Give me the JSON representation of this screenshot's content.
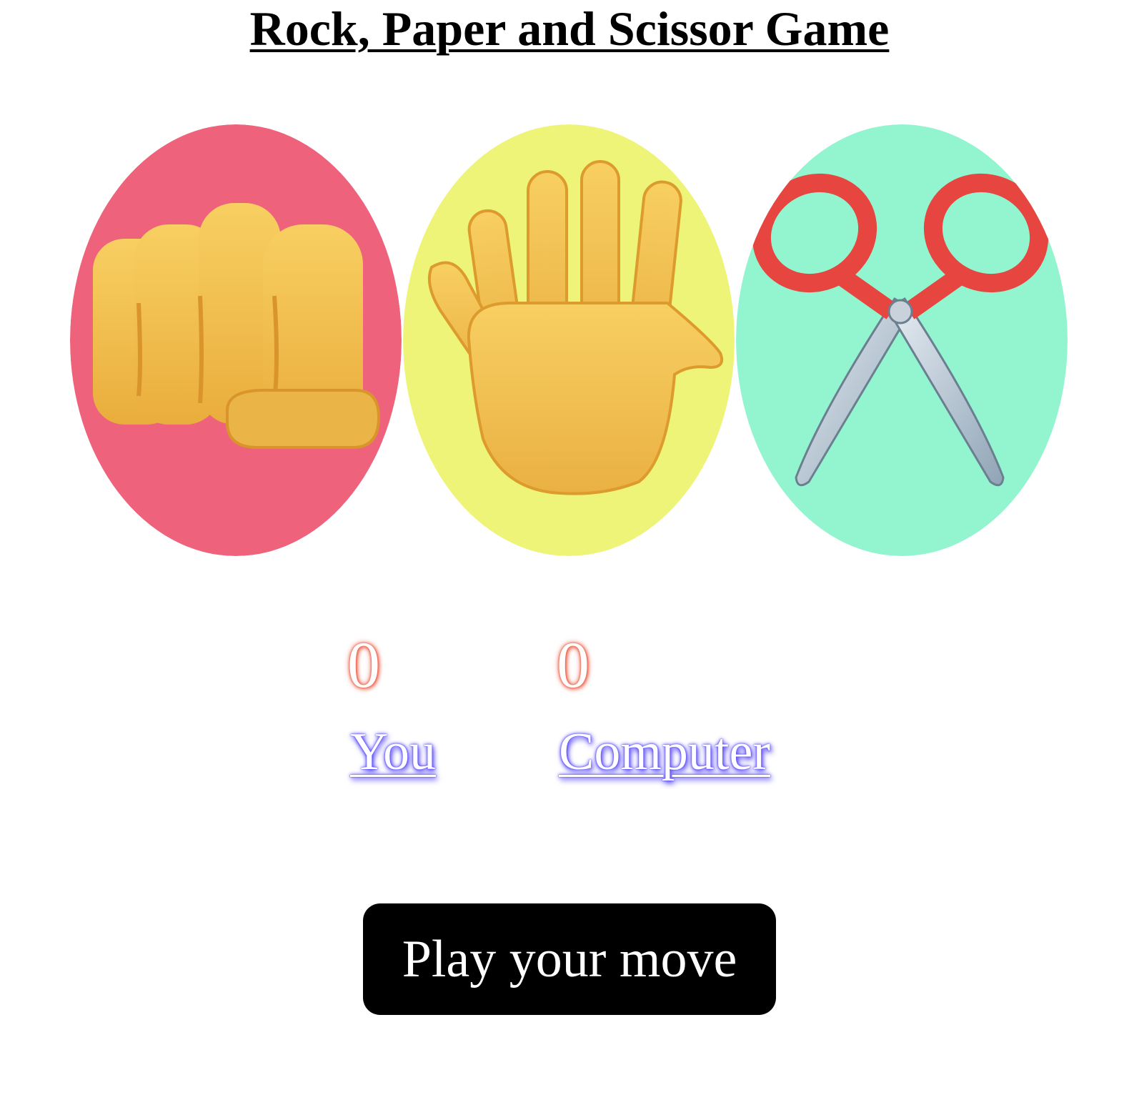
{
  "title": "Rock, Paper and Scissor Game",
  "choices": [
    {
      "id": "rock",
      "icon": "fist-icon",
      "color": "#ee637b"
    },
    {
      "id": "paper",
      "icon": "raised-hand-icon",
      "color": "#eef478"
    },
    {
      "id": "scissors",
      "icon": "scissors-icon",
      "color": "#93f5cf"
    }
  ],
  "scoreboard": {
    "user_score": "0",
    "user_label": "You",
    "comp_score": "0",
    "comp_label": "Computer"
  },
  "message": "Play your move"
}
